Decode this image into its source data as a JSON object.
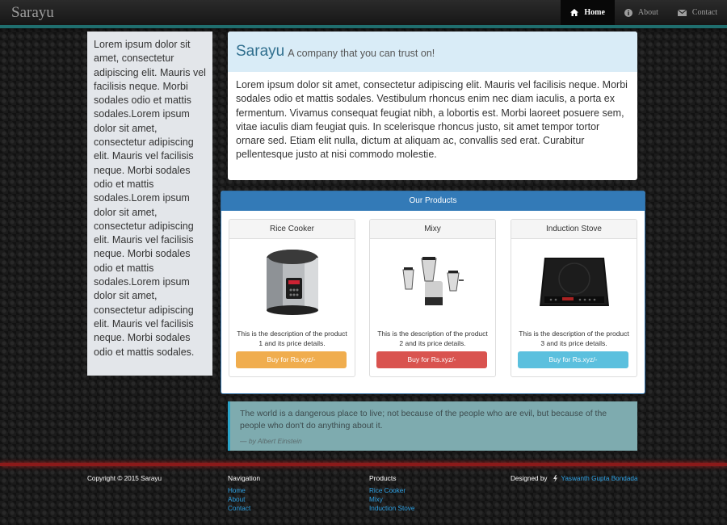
{
  "navbar": {
    "brand": "Sarayu",
    "items": [
      {
        "label": "Home",
        "icon": "home-icon"
      },
      {
        "label": "About",
        "icon": "info-icon"
      },
      {
        "label": "Contact",
        "icon": "mail-icon"
      }
    ]
  },
  "sidebar": {
    "text": "Lorem ipsum dolor sit amet, consectetur adipiscing elit. Mauris vel facilisis neque. Morbi sodales odio et mattis sodales.Lorem ipsum dolor sit amet, consectetur adipiscing elit. Mauris vel facilisis neque. Morbi sodales odio et mattis sodales.Lorem ipsum dolor sit amet, consectetur adipiscing elit. Mauris vel facilisis neque. Morbi sodales odio et mattis sodales.Lorem ipsum dolor sit amet, consectetur adipiscing elit. Mauris vel facilisis neque. Morbi sodales odio et mattis sodales."
  },
  "jumbo": {
    "title": "Sarayu",
    "tagline": "A company that you can trust on!",
    "body": "Lorem ipsum dolor sit amet, consectetur adipiscing elit. Mauris vel facilisis neque. Morbi sodales odio et mattis sodales. Vestibulum rhoncus enim nec diam iaculis, a porta ex fermentum. Vivamus consequat feugiat nibh, a lobortis est. Morbi laoreet posuere sem, vitae iaculis diam feugiat quis. In scelerisque rhoncus justo, sit amet tempor tortor ornare sed. Etiam elit nulla, dictum at aliquam ac, convallis sed erat. Curabitur pellentesque justo at nisi commodo molestie."
  },
  "products": {
    "heading": "Our Products",
    "items": [
      {
        "name": "Rice Cooker",
        "desc": "This is the description of the product 1 and its price details.",
        "button": "Buy for Rs.xyz/-",
        "color": "#f0ad4e"
      },
      {
        "name": "Mixy",
        "desc": "This is the description of the product 2 and its price details.",
        "button": "Buy for Rs.xyz/-",
        "color": "#d9534f"
      },
      {
        "name": "Induction Stove",
        "desc": "This is the description of the product 3 and its price details.",
        "button": "Buy for Rs.xyz/-",
        "color": "#5bc0de"
      }
    ]
  },
  "quote": {
    "text": "The world is a dangerous place to live; not because of the people who are evil, but because of the people who don't do anything about it.",
    "author": "— by Albert Einstein"
  },
  "footer": {
    "copyright": "Copyright © 2015 Sarayu",
    "navigation_heading": "Navigation",
    "navigation": [
      "Home",
      "About",
      "Contact"
    ],
    "products_heading": "Products",
    "products": [
      "Rice Cooker",
      "Mixy",
      "Induction Stove"
    ],
    "designed_by": "Designed by",
    "designer": "Yaswanth Gupta Bondada"
  }
}
